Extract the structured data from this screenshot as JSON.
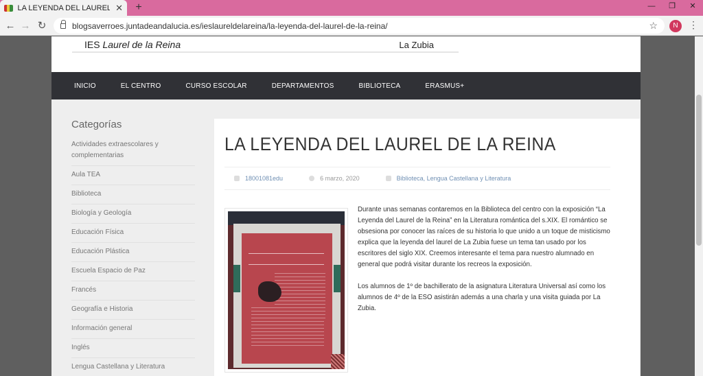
{
  "browser": {
    "tab_title": "LA LEYENDA DEL LAUREL DE LA R",
    "tab_close": "✕",
    "new_tab": "+",
    "url": "blogsaverroes.juntadeandalucia.es/ieslaureldelareina/la-leyenda-del-laurel-de-la-reina/",
    "profile_initial": "N",
    "window_controls": [
      "—",
      "❐",
      "✕"
    ]
  },
  "site": {
    "banner_school_prefix": "IES ",
    "banner_school_name": "Laurel de la Reina",
    "banner_town": "La Zubia",
    "nav": [
      "INICIO",
      "EL CENTRO",
      "CURSO ESCOLAR",
      "DEPARTAMENTOS",
      "BIBLIOTECA",
      "ERASMUS+"
    ]
  },
  "sidebar": {
    "heading": "Categorías",
    "items": [
      "Actividades extraescolares y complementarias",
      "Aula TEA",
      "Biblioteca",
      "Biología y Geología",
      "Educación Física",
      "Educación Plástica",
      "Escuela Espacio de Paz",
      "Francés",
      "Geografía e Historia",
      "Información general",
      "Inglés",
      "Lengua Castellana y Literatura"
    ]
  },
  "post": {
    "title": "LA LEYENDA DEL LAUREL DE LA REINA",
    "author": "18001081edu",
    "date": "6 marzo, 2020",
    "categories": "Biblioteca, Lengua Castellana y Literatura",
    "paragraph1": "Durante unas semanas contaremos en la Biblioteca del centro con la exposición “La Leyenda del Laurel de la Reina” en la Literatura romántica del s.XIX. El romántico se obsesiona por conocer las raíces de su historia lo que unido a un toque de misticismo explica que la leyenda del laurel de La Zubia fuese un tema tan usado por los escritores del siglo XIX. Creemos interesante el tema para nuestro alumnado en general que podrá visitar durante los recreos la exposición.",
    "paragraph2": "Los alumnos de 1º de bachillerato de la asignatura Literatura Universal así como los alumnos de 4º de la ESO asistirán además a una charla y una visita guiada por La Zubia."
  }
}
